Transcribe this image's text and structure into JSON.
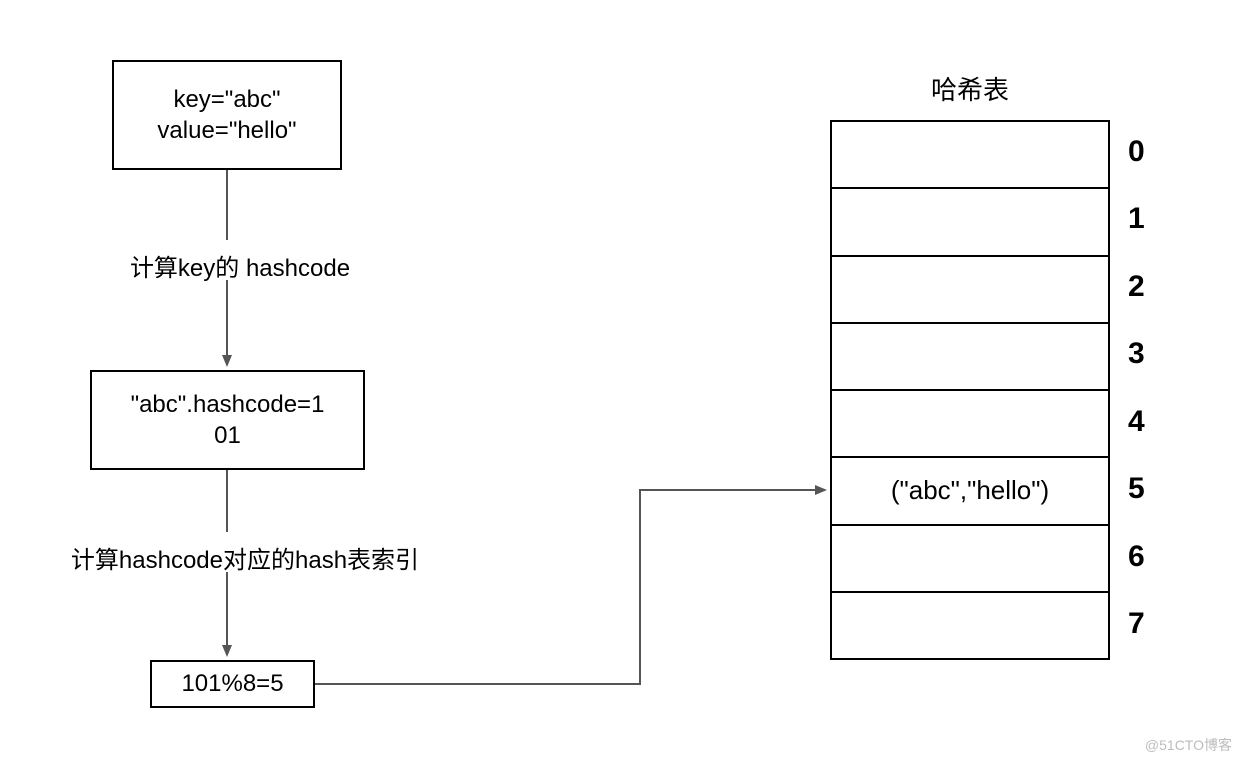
{
  "flow": {
    "box1_line1": "key=\"abc\"",
    "box1_line2": "value=\"hello\"",
    "edge1_label": "计算key的 hashcode",
    "box2_line1": "\"abc\".hashcode=1",
    "box2_line2": "01",
    "edge2_label": "计算hashcode对应的hash表索引",
    "box3": "101%8=5"
  },
  "table": {
    "title": "哈希表",
    "rows": [
      "",
      "",
      "",
      "",
      "",
      "(\"abc\",\"hello\")",
      "",
      ""
    ],
    "indices": [
      "0",
      "1",
      "2",
      "3",
      "4",
      "5",
      "6",
      "7"
    ]
  },
  "watermark": "@51CTO博客"
}
